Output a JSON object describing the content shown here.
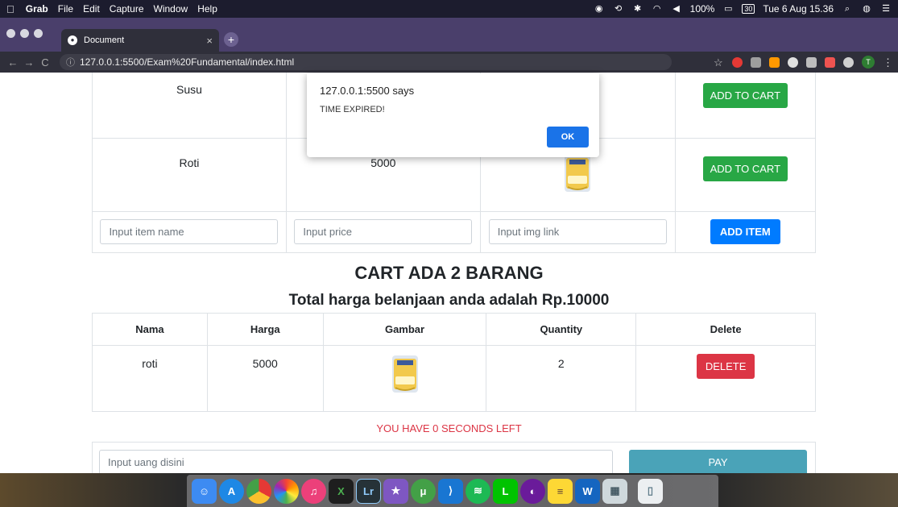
{
  "menubar": {
    "app_name": "Grab",
    "menus": [
      "File",
      "Edit",
      "Capture",
      "Window",
      "Help"
    ],
    "battery": "100%",
    "calendar_day": "30",
    "datetime": "Tue 6 Aug  15.36"
  },
  "browser": {
    "tab_title": "Document",
    "new_tab": "+",
    "url": "127.0.0.1:5500/Exam%20Fundamental/index.html",
    "profile_initial": "T"
  },
  "items": [
    {
      "name": "Susu",
      "price": "",
      "button": "ADD TO CART"
    },
    {
      "name": "Roti",
      "price": "5000",
      "button": "ADD TO CART"
    }
  ],
  "form": {
    "name_placeholder": "Input item name",
    "price_placeholder": "Input price",
    "img_placeholder": "Input img link",
    "add_button": "ADD ITEM"
  },
  "cart": {
    "title": "CART ADA 2 BARANG",
    "total": "Total harga belanjaan anda adalah Rp.10000",
    "headers": [
      "Nama",
      "Harga",
      "Gambar",
      "Quantity",
      "Delete"
    ],
    "rows": [
      {
        "name": "roti",
        "price": "5000",
        "quantity": "2",
        "delete": "DELETE"
      }
    ]
  },
  "timer": "YOU HAVE 0 SECONDS LEFT",
  "pay": {
    "placeholder": "Input uang disini",
    "button": "PAY"
  },
  "alert": {
    "origin": "127.0.0.1:5500 says",
    "message": "TIME EXPIRED!",
    "ok": "OK"
  },
  "dock_apps": [
    "finder",
    "app-store",
    "chrome",
    "photos",
    "itunes",
    "excel",
    "lightroom",
    "imovie",
    "utorrent",
    "vscode",
    "spotify",
    "line",
    "github",
    "notes",
    "word",
    "preview",
    "trash"
  ],
  "colors": {
    "green": "#28a745",
    "blue": "#007bff",
    "red": "#dc3545",
    "teal": "#4aa3b8"
  }
}
